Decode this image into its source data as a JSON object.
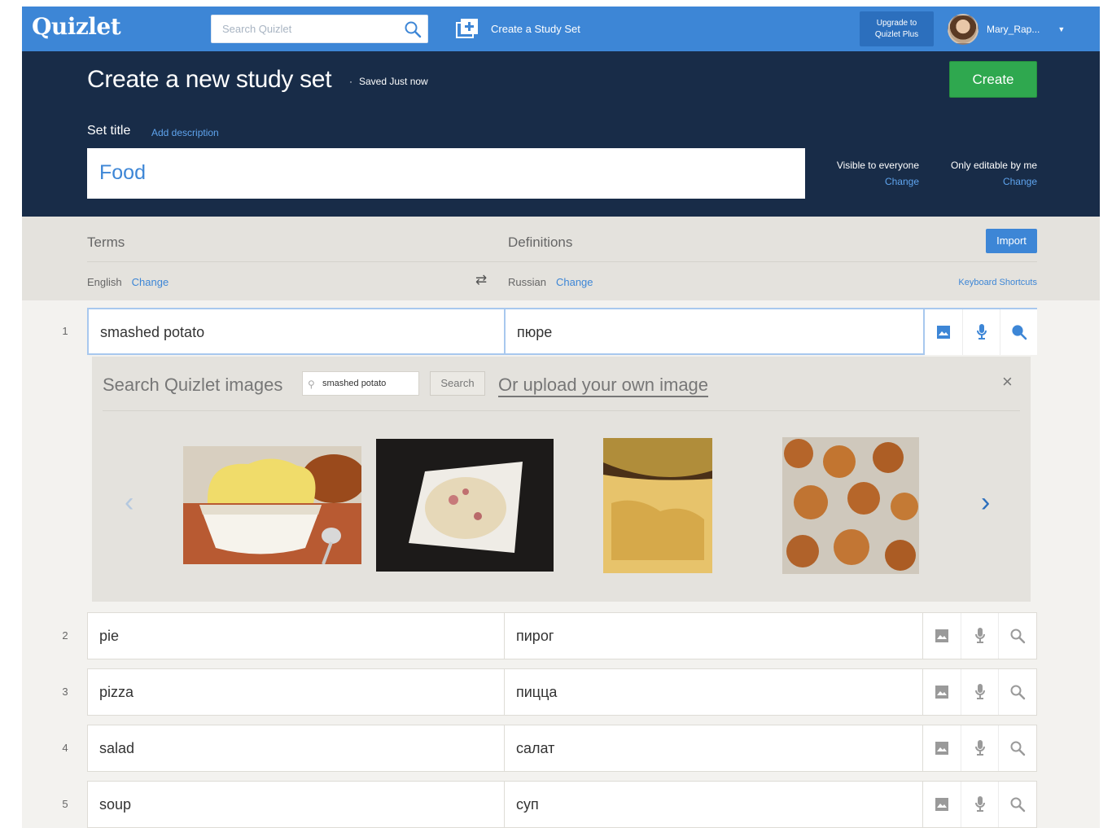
{
  "nav": {
    "logo": "Quizlet",
    "search_placeholder": "Search Quizlet",
    "create_label": "Create a Study Set",
    "upgrade_line1": "Upgrade to",
    "upgrade_line2": "Quizlet Plus",
    "user_name": "Mary_Rap..."
  },
  "header": {
    "title": "Create a new study set",
    "saved": "Saved Just now",
    "create_label": "Create",
    "set_title_label": "Set title",
    "add_description": "Add description",
    "set_title_value": "Food",
    "visibility": {
      "label": "Visible to everyone",
      "change": "Change"
    },
    "editable": {
      "label": "Only editable by me",
      "change": "Change"
    }
  },
  "columns": {
    "terms": "Terms",
    "definitions": "Definitions",
    "import_label": "Import",
    "term_lang": "English",
    "def_lang": "Russian",
    "change": "Change",
    "shortcuts": "Keyboard Shortcuts"
  },
  "image_search": {
    "title": "Search Quizlet images",
    "query": "smashed potato",
    "search_label": "Search",
    "upload_label": "Or upload your own image",
    "close": "×",
    "images": [
      "mashed-potato-bowl",
      "potato-salad-dish",
      "potato-fries-plate",
      "smashed-potatoes-tray"
    ]
  },
  "rows": [
    {
      "num": "1",
      "term": "smashed potato",
      "definition": "пюре"
    },
    {
      "num": "2",
      "term": "pie",
      "definition": "пирог"
    },
    {
      "num": "3",
      "term": "pizza",
      "definition": "пицца"
    },
    {
      "num": "4",
      "term": "salad",
      "definition": "салат"
    },
    {
      "num": "5",
      "term": "soup",
      "definition": "суп"
    }
  ],
  "colors": {
    "nav_blue": "#3d86d6",
    "header_navy": "#182c48",
    "create_green": "#2fa84f",
    "link_blue": "#3d86d6"
  }
}
